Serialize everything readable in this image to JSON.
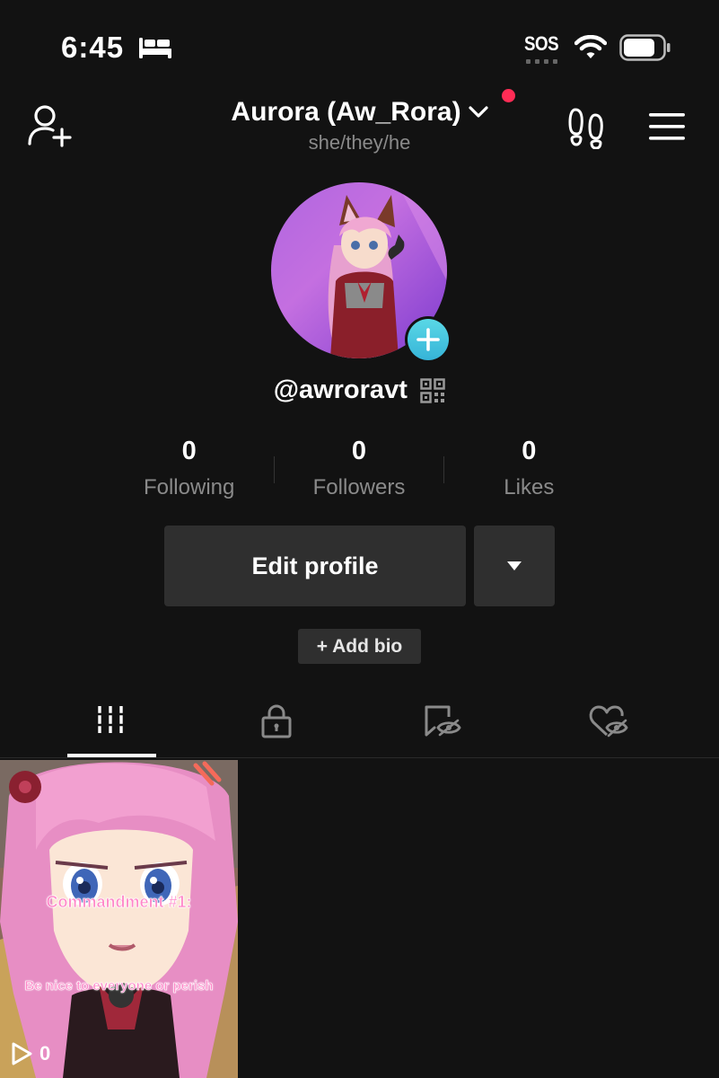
{
  "status_bar": {
    "time": "6:45",
    "sos_label": "SOS",
    "icons": [
      "bed-icon",
      "wifi-icon",
      "battery-icon"
    ]
  },
  "header": {
    "display_name": "Aurora (Aw_Rora)",
    "pronouns": "she/they/he",
    "icons": [
      "add-user-icon",
      "chevron-down-icon",
      "footprint-icon",
      "menu-icon"
    ]
  },
  "profile": {
    "username": "@awroravt",
    "accent_color": "#fe2c55",
    "add_button_color": "#4cc9e0"
  },
  "stats": [
    {
      "value": "0",
      "label": "Following"
    },
    {
      "value": "0",
      "label": "Followers"
    },
    {
      "value": "0",
      "label": "Likes"
    }
  ],
  "actions": {
    "edit_profile": "Edit profile",
    "add_bio": "+ Add bio"
  },
  "tabs": [
    {
      "name": "videos",
      "icon": "grid-icon",
      "active": true
    },
    {
      "name": "private",
      "icon": "lock-icon",
      "active": false
    },
    {
      "name": "saved",
      "icon": "bookmark-eye-icon",
      "active": false
    },
    {
      "name": "liked",
      "icon": "heart-eye-icon",
      "active": false
    }
  ],
  "videos": [
    {
      "caption_line1": "Commandment #1:",
      "caption_line2": "Be nice to everyone or perish",
      "views": "0"
    }
  ]
}
